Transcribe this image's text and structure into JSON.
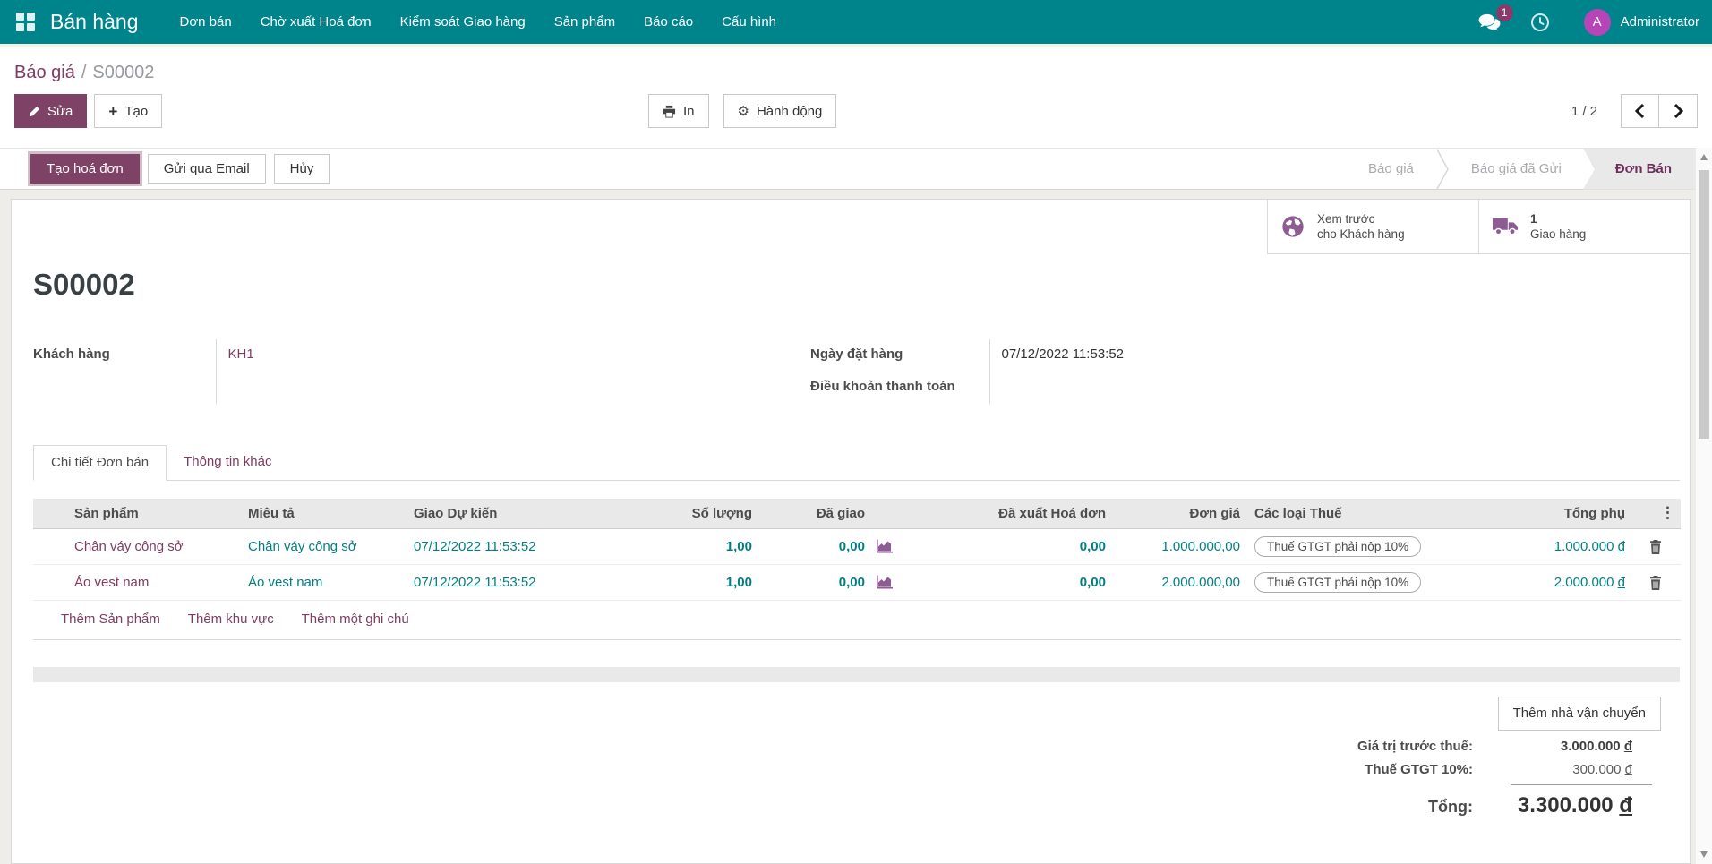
{
  "navbar": {
    "brand": "Bán hàng",
    "menus": [
      "Đơn bán",
      "Chờ xuất Hoá đơn",
      "Kiểm soát Giao hàng",
      "Sản phẩm",
      "Báo cáo",
      "Cấu hình"
    ],
    "messages_badge": "1",
    "user": {
      "initial": "A",
      "name": "Administrator"
    }
  },
  "breadcrumb": {
    "parent": "Báo giá",
    "separator": "/",
    "current": "S00002"
  },
  "actions": {
    "edit": "Sửa",
    "create": "Tạo",
    "print": "In",
    "action": "Hành động",
    "pager": "1 / 2"
  },
  "statusbar": {
    "create_invoice": "Tạo hoá đơn",
    "send_email": "Gửi qua Email",
    "cancel": "Hủy",
    "steps": [
      {
        "label": "Báo giá",
        "active": false
      },
      {
        "label": "Báo giá đã Gửi",
        "active": false
      },
      {
        "label": "Đơn Bán",
        "active": true
      }
    ]
  },
  "smart_buttons": {
    "preview": {
      "line1": "Xem trước",
      "line2": "cho Khách hàng"
    },
    "delivery": {
      "count": "1",
      "label": "Giao hàng"
    }
  },
  "form": {
    "title": "S00002",
    "customer": {
      "label": "Khách hàng",
      "value": "KH1"
    },
    "order_date": {
      "label": "Ngày đặt hàng",
      "value": "07/12/2022 11:53:52"
    },
    "payment_terms": {
      "label": "Điều khoản thanh toán",
      "value": ""
    },
    "tabs": [
      {
        "label": "Chi tiết Đơn bán",
        "active": true
      },
      {
        "label": "Thông tin khác",
        "active": false
      }
    ]
  },
  "order_lines": {
    "columns": {
      "product": "Sản phẩm",
      "description": "Miêu tả",
      "expected_delivery": "Giao Dự kiến",
      "quantity": "Số lượng",
      "delivered": "Đã giao",
      "invoiced": "Đã xuất Hoá đơn",
      "unit_price": "Đơn giá",
      "taxes": "Các loại Thuế",
      "subtotal": "Tổng phụ",
      "options": "⋮"
    },
    "rows": [
      {
        "product": "Chân váy công sở",
        "description": "Chân váy công sở",
        "expected_delivery": "07/12/2022 11:53:52",
        "quantity": "1,00",
        "delivered": "0,00",
        "invoiced": "0,00",
        "unit_price": "1.000.000,00",
        "tax": "Thuế GTGT phải nộp 10%",
        "subtotal": "1.000.000",
        "currency": "đ"
      },
      {
        "product": "Áo vest nam",
        "description": "Áo vest nam",
        "expected_delivery": "07/12/2022 11:53:52",
        "quantity": "1,00",
        "delivered": "0,00",
        "invoiced": "0,00",
        "unit_price": "2.000.000,00",
        "tax": "Thuế GTGT phải nộp 10%",
        "subtotal": "2.000.000",
        "currency": "đ"
      }
    ],
    "add_links": [
      "Thêm Sản phẩm",
      "Thêm khu vực",
      "Thêm một ghi chú"
    ]
  },
  "totals": {
    "add_carrier": "Thêm nhà vận chuyển",
    "untaxed": {
      "label": "Giá trị trước thuế:",
      "value": "3.000.000",
      "currency": "đ"
    },
    "tax": {
      "label": "Thuế GTGT 10%:",
      "value": "300.000",
      "currency": "đ"
    },
    "total": {
      "label": "Tổng:",
      "value": "3.300.000",
      "currency": "đ"
    }
  },
  "colors": {
    "nav_teal": "#00848c",
    "primary_purple": "#7d4265",
    "link_purple": "#7d3c62",
    "value_teal": "#017e84",
    "avatar_magenta": "#b845b8",
    "badge_plum": "#8a3a6a",
    "table_header_gray": "#e9e9e9"
  }
}
